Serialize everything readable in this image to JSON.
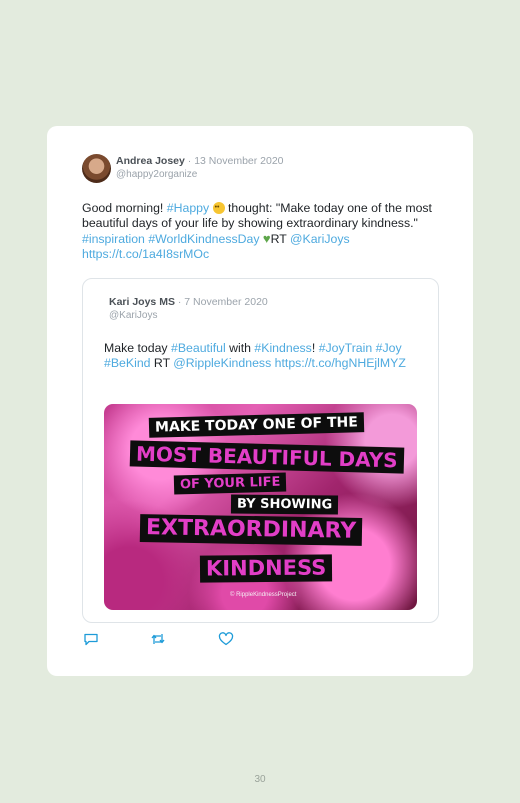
{
  "tweet": {
    "author_name": "Andrea Josey",
    "date": "· 13 November 2020",
    "handle": "@happy2organize",
    "text": {
      "p1": "Good morning! ",
      "tag_happy": "#Happy",
      "p2": " thought: \"Make today one of the most beautiful days of your life by showing extraordinary kindness.\" ",
      "tag_inspiration": "#inspiration",
      "tag_wkd": "#WorldKindnessDay",
      "p3": "RT",
      "mention": "@KariJoys",
      "link": "https://t.co/1a4I8srMOc"
    }
  },
  "quoted_tweet": {
    "author_name": "Kari Joys MS",
    "date": "· 7 November 2020",
    "handle": "@KariJoys",
    "text": {
      "p1": "Make today ",
      "tag_beautiful": "#Beautiful",
      "p2": " with ",
      "tag_kindness": "#Kindness",
      "p3": "! ",
      "tag_joytrain": "#JoyTrain",
      "tag_joy": "#Joy",
      "tag_bekind": "#BeKind",
      "p4": " RT ",
      "mention": "@RippleKindness",
      "link": "https://t.co/hgNHEjlMYZ"
    },
    "image": {
      "line1": "Make today one of the",
      "line2": "most beautiful days",
      "line3": "of your life",
      "line4": "by showing",
      "line5": "extraordinary",
      "line6": "kindness",
      "watermark": "© RippleKindnessProject"
    }
  },
  "actions": {
    "reply_icon": "reply-icon",
    "retweet_icon": "retweet-icon",
    "like_icon": "heart-icon"
  },
  "page_number": "30",
  "colors": {
    "page_bg": "#e3ebde",
    "link_blue": "#4eaadf",
    "banner_pink": "#e23ec7"
  }
}
